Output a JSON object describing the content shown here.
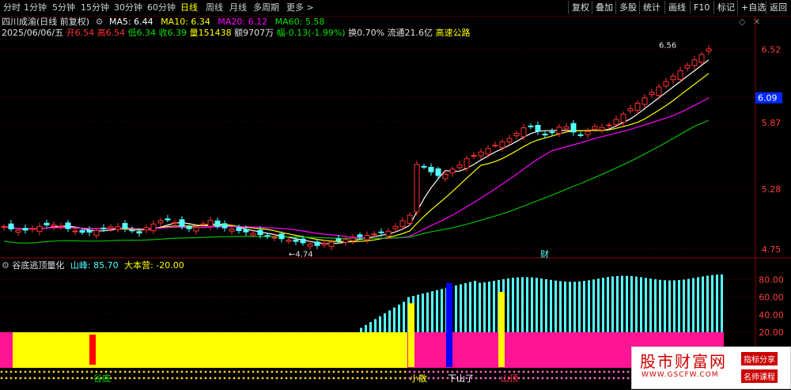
{
  "toolbar": {
    "tabs": [
      "分时",
      "1分钟",
      "5分钟",
      "15分钟",
      "30分钟",
      "60分钟",
      "日线",
      "周线",
      "月线",
      "多周期",
      "更多 >"
    ],
    "active_tab": "日线",
    "right_buttons": [
      "复权",
      "叠加",
      "多股",
      "统计",
      "画线",
      "F10",
      "标记",
      "+自选",
      "返回"
    ]
  },
  "header": {
    "stock_name": "四川成渝(日线 前复权)",
    "ma5_label": "MA5: 6.44",
    "ma10_label": "MA10: 6.34",
    "ma20_label": "MA20: 6.12",
    "ma60_label": "MA60: 5.58"
  },
  "quote": {
    "date": "2025/06/06/五",
    "open": "开6.54",
    "high": "高6.54",
    "low": "低6.34",
    "close": "收6.39",
    "volume": "量151438",
    "amount": "额9707万",
    "change": "幅-0.13(-1.99%)",
    "turnover": "换0.70%",
    "float_cap": "流通21.6亿",
    "sector": "高速公路"
  },
  "indicator": {
    "name": "谷底逃顶量化",
    "shanfeng_label": "山峰: 85.70",
    "dabenying_label": "大本营: -20.00"
  },
  "colors": {
    "up": "#ff3232",
    "down": "#54ffff",
    "ma5": "#ffffff",
    "ma10": "#ffff00",
    "ma20": "#ff00ff",
    "ma60": "#00c000",
    "pink": "#ff1493",
    "yellow": "#ffff00",
    "blue": "#0000ff"
  },
  "chart_data": [
    {
      "type": "candlestick",
      "price_axis_ticks": [
        "6.52",
        "6.09",
        "5.87",
        "5.28",
        "4.75"
      ],
      "current_price_tag": "6.09",
      "ylim": [
        4.7,
        6.62
      ],
      "annotations": {
        "high": "6.56",
        "low": "4.74",
        "event_marker": "财"
      },
      "moving_averages": [
        "MA5",
        "MA10",
        "MA20",
        "MA60"
      ]
    },
    {
      "type": "bar",
      "title": "谷底逃顶量化",
      "y_ticks": [
        "80.00",
        "60.00",
        "40.00",
        "20.00"
      ],
      "ylim": [
        20,
        92
      ],
      "series": [
        {
          "name": "山峰",
          "last_value": 85.7
        },
        {
          "name": "大本营",
          "last_value": -20.0
        }
      ],
      "signals": [
        "谷底",
        "小散",
        "下山了",
        "山顶"
      ]
    }
  ],
  "watermark": {
    "title": "股市财富网",
    "url": "WWW.GSCFW.COM",
    "link1": "指标分享",
    "link2": "名师课程"
  }
}
